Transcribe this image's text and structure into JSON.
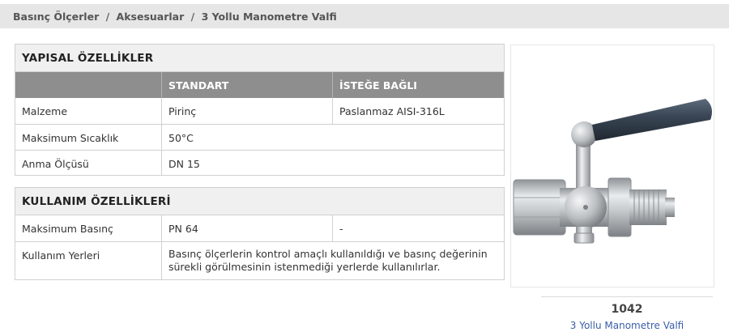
{
  "breadcrumb": {
    "items": [
      "Basınç Ölçerler",
      "Aksesuarlar",
      "3 Yollu Manometre Valfi"
    ],
    "separator": "/"
  },
  "structural": {
    "title": "YAPISAL ÖZELLİKLER",
    "columns": [
      "",
      "STANDART",
      "İSTEĞE BAĞLI"
    ],
    "rows": [
      {
        "label": "Malzeme",
        "standard": "Pirinç",
        "optional": "Paslanmaz AISI-316L"
      },
      {
        "label": "Maksimum Sıcaklık",
        "value": "50°C"
      },
      {
        "label": "Anma Ölçüsü",
        "value": "DN 15"
      }
    ]
  },
  "usage": {
    "title": "KULLANIM ÖZELLİKLERİ",
    "rows": [
      {
        "label": "Maksimum Basınç",
        "standard": "PN 64",
        "optional": "-"
      },
      {
        "label": "Kullanım Yerleri",
        "value": "Basınç ölçerlerin kontrol amaçlı kullanıldığı ve basınç değerinin sürekli görülmesinin istenmediği yerlerde kullanılırlar."
      }
    ]
  },
  "product": {
    "code": "1042",
    "name": "3 Yollu Manometre Valfi",
    "image_icon": "valve-image"
  },
  "colors": {
    "header_bg": "#8e8e8e",
    "section_head_bg": "#f0f0f0",
    "breadcrumb_bg": "#e6e6e6",
    "link": "#3a5ea8"
  }
}
